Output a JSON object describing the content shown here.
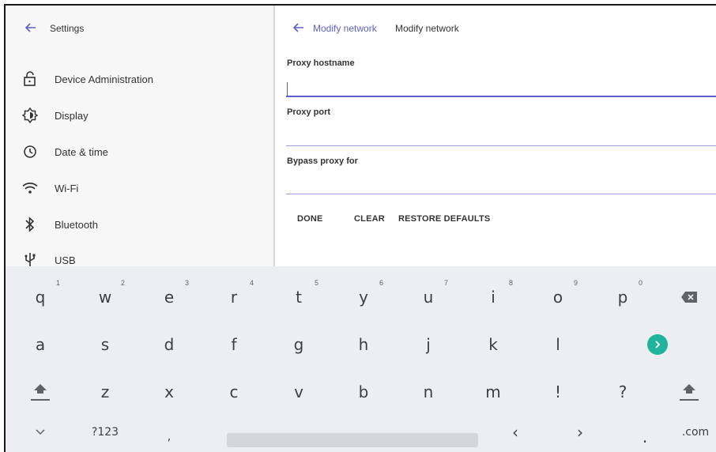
{
  "left": {
    "title": "Settings",
    "items": [
      {
        "label": "Device Administration",
        "icon": "lock-open-icon"
      },
      {
        "label": "Display",
        "icon": "brightness-icon"
      },
      {
        "label": "Date & time",
        "icon": "clock-icon"
      },
      {
        "label": "Wi-Fi",
        "icon": "wifi-icon"
      },
      {
        "label": "Bluetooth",
        "icon": "bluetooth-icon"
      },
      {
        "label": "USB",
        "icon": "usb-icon"
      }
    ]
  },
  "right": {
    "breadcrumb_link": "Modify network",
    "breadcrumb_current": "Modify network",
    "fields": {
      "proxy_hostname": {
        "label": "Proxy hostname",
        "value": ""
      },
      "proxy_port": {
        "label": "Proxy port",
        "value": ""
      },
      "bypass": {
        "label": "Bypass proxy for",
        "value": ""
      }
    },
    "actions": {
      "done": "DONE",
      "clear": "CLEAR",
      "restore": "RESTORE DEFAULTS"
    }
  },
  "keyboard": {
    "row1": [
      {
        "key": "q",
        "hint": "1"
      },
      {
        "key": "w",
        "hint": "2"
      },
      {
        "key": "e",
        "hint": "3"
      },
      {
        "key": "r",
        "hint": "4"
      },
      {
        "key": "t",
        "hint": "5"
      },
      {
        "key": "y",
        "hint": "6"
      },
      {
        "key": "u",
        "hint": "7"
      },
      {
        "key": "i",
        "hint": "8"
      },
      {
        "key": "o",
        "hint": "9"
      },
      {
        "key": "p",
        "hint": "0"
      }
    ],
    "row2": [
      "a",
      "s",
      "d",
      "f",
      "g",
      "h",
      "j",
      "k",
      "l"
    ],
    "row3": [
      "z",
      "x",
      "c",
      "v",
      "b",
      "n",
      "m",
      "!",
      "?"
    ],
    "row4": {
      "symbols": "?123",
      "comma": ",",
      "left_arrow": "‹",
      "right_arrow": "›",
      "period": ".",
      "dotcom": ".com"
    }
  },
  "colors": {
    "accent": "#5b5fc7",
    "enter": "#22b39e",
    "keyboard_bg": "#eceef1"
  }
}
